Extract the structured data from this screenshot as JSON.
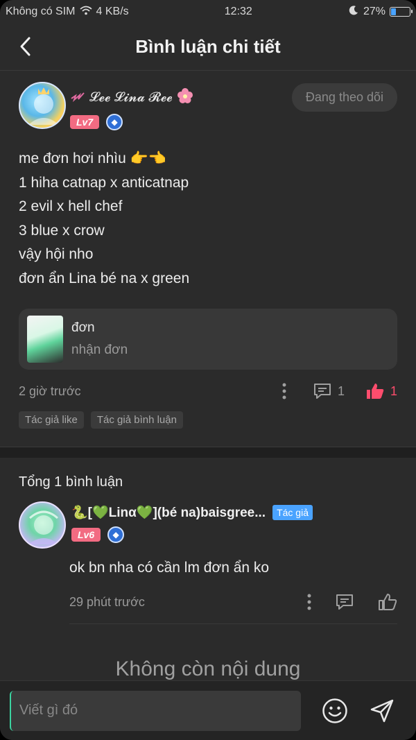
{
  "status_bar": {
    "carrier": "Không có SIM",
    "network_speed": "4 KB/s",
    "time": "12:32",
    "battery_level": "27%",
    "battery_fraction": 0.27
  },
  "header": {
    "title": "Bình luận chi tiết"
  },
  "post": {
    "author_name": "𝓛𝓮𝓮 𝓛𝓲𝓷𝓪 𝓡𝓮𝓮",
    "level": "Lv7",
    "follow_label": "Đang theo dõi",
    "body_lines": [
      "me đơn hơi nhìu 👉👈",
      "1 hiha catnap x anticatnap",
      "2 evil x hell chef",
      "3 blue x crow",
      "vậy hội nho",
      "đơn ẩn Lina bé na x green"
    ],
    "attachment": {
      "title": "đơn",
      "subtitle": "nhận đơn"
    },
    "time": "2 giờ trước",
    "comment_count": "1",
    "like_count": "1",
    "tags": [
      "Tác giả like",
      "Tác giả bình luận"
    ]
  },
  "comments": {
    "total_label": "Tổng 1 bình luận",
    "items": [
      {
        "author_name": "🐍[💚Linα💚](bé na)baisgree...",
        "author_tag": "Tác giả",
        "level": "Lv6",
        "body": "ok bn nha có cần lm đơn ẩn ko",
        "time": "29 phút trước"
      }
    ],
    "no_more_label": "Không còn nội dung"
  },
  "input_bar": {
    "placeholder": "Viết gì đó"
  },
  "colors": {
    "background": "#2b2b2b",
    "accent_pink": "#f26b82",
    "like_red": "#ff4d6d",
    "author_tag_blue": "#4aa3ff"
  }
}
